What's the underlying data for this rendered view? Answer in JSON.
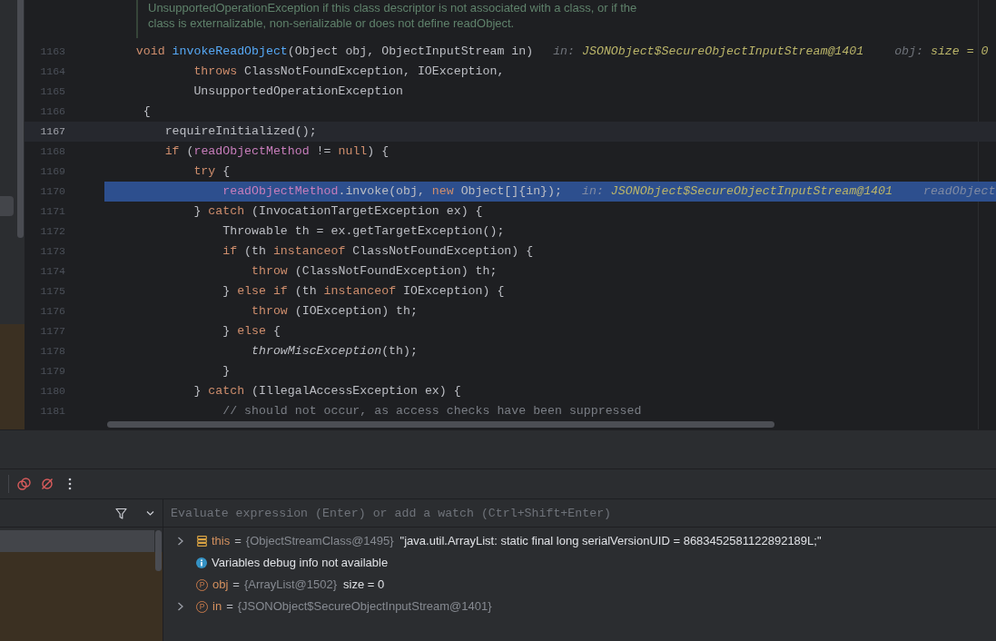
{
  "editor": {
    "doc_comment": {
      "lines": [
        "UnsupportedOperationException if this class descriptor is not associated with a class, or if the",
        "class is externalizable, non-serializable or does not define readObject."
      ]
    },
    "lines": [
      {
        "number": "1163",
        "caret": false,
        "execution_point": false,
        "tokens": [
          {
            "text": "    void",
            "kind": "keyword"
          },
          {
            "text": " invokeReadObject",
            "kind": "method_declaration"
          },
          {
            "text": "(Object obj, ObjectInputStream in)",
            "kind": "plain"
          }
        ],
        "hints": [
          {
            "label": "in:",
            "value": "JSONObject$SecureObjectInputStream@1401"
          },
          {
            "label": "obj:",
            "value": "size = 0"
          }
        ]
      },
      {
        "number": "1164",
        "caret": false,
        "execution_point": false,
        "tokens": [
          {
            "text": "            throws",
            "kind": "keyword"
          },
          {
            "text": " ClassNotFoundException, IOException,",
            "kind": "plain"
          }
        ]
      },
      {
        "number": "1165",
        "caret": false,
        "execution_point": false,
        "tokens": [
          {
            "text": "            UnsupportedOperationException",
            "kind": "plain"
          }
        ]
      },
      {
        "number": "1166",
        "caret": false,
        "execution_point": false,
        "tokens": [
          {
            "text": "     {",
            "kind": "plain"
          }
        ]
      },
      {
        "number": "1167",
        "caret": true,
        "execution_point": false,
        "tokens": [
          {
            "text": "        requireInitialized();",
            "kind": "plain"
          }
        ]
      },
      {
        "number": "1168",
        "caret": false,
        "execution_point": false,
        "tokens": [
          {
            "text": "        if",
            "kind": "keyword"
          },
          {
            "text": " (",
            "kind": "plain"
          },
          {
            "text": "readObjectMethod",
            "kind": "field"
          },
          {
            "text": " != ",
            "kind": "plain"
          },
          {
            "text": "null",
            "kind": "keyword"
          },
          {
            "text": ") {",
            "kind": "plain"
          }
        ]
      },
      {
        "number": "1169",
        "caret": false,
        "execution_point": false,
        "tokens": [
          {
            "text": "            try",
            "kind": "keyword"
          },
          {
            "text": " {",
            "kind": "plain"
          }
        ]
      },
      {
        "number": "1170",
        "caret": false,
        "execution_point": true,
        "tokens": [
          {
            "text": "                readObjectMethod",
            "kind": "field"
          },
          {
            "text": ".invoke(obj, ",
            "kind": "plain"
          },
          {
            "text": "new",
            "kind": "keyword"
          },
          {
            "text": " Object[]{in});",
            "kind": "plain"
          }
        ],
        "hints": [
          {
            "label": "in:",
            "value": "JSONObject$SecureObjectInputStream@1401"
          },
          {
            "label": "readObject"
          }
        ]
      },
      {
        "number": "1171",
        "caret": false,
        "execution_point": false,
        "tokens": [
          {
            "text": "            } ",
            "kind": "plain"
          },
          {
            "text": "catch",
            "kind": "keyword"
          },
          {
            "text": " (InvocationTargetException ex) {",
            "kind": "plain"
          }
        ]
      },
      {
        "number": "1172",
        "caret": false,
        "execution_point": false,
        "tokens": [
          {
            "text": "                Throwable th = ex.getTargetException();",
            "kind": "plain"
          }
        ]
      },
      {
        "number": "1173",
        "caret": false,
        "execution_point": false,
        "tokens": [
          {
            "text": "                if",
            "kind": "keyword"
          },
          {
            "text": " (th ",
            "kind": "plain"
          },
          {
            "text": "instanceof",
            "kind": "keyword"
          },
          {
            "text": " ClassNotFoundException) {",
            "kind": "plain"
          }
        ]
      },
      {
        "number": "1174",
        "caret": false,
        "execution_point": false,
        "tokens": [
          {
            "text": "                    throw",
            "kind": "keyword"
          },
          {
            "text": " (ClassNotFoundException) th;",
            "kind": "plain"
          }
        ]
      },
      {
        "number": "1175",
        "caret": false,
        "execution_point": false,
        "tokens": [
          {
            "text": "                } ",
            "kind": "plain"
          },
          {
            "text": "else if",
            "kind": "keyword"
          },
          {
            "text": " (th ",
            "kind": "plain"
          },
          {
            "text": "instanceof",
            "kind": "keyword"
          },
          {
            "text": " IOException) {",
            "kind": "plain"
          }
        ]
      },
      {
        "number": "1176",
        "caret": false,
        "execution_point": false,
        "tokens": [
          {
            "text": "                    throw",
            "kind": "keyword"
          },
          {
            "text": " (IOException) th;",
            "kind": "plain"
          }
        ]
      },
      {
        "number": "1177",
        "caret": false,
        "execution_point": false,
        "tokens": [
          {
            "text": "                } ",
            "kind": "plain"
          },
          {
            "text": "else",
            "kind": "keyword"
          },
          {
            "text": " {",
            "kind": "plain"
          }
        ]
      },
      {
        "number": "1178",
        "caret": false,
        "execution_point": false,
        "tokens": [
          {
            "text": "                    throwMiscException",
            "kind": "static_call"
          },
          {
            "text": "(th);",
            "kind": "plain"
          }
        ]
      },
      {
        "number": "1179",
        "caret": false,
        "execution_point": false,
        "tokens": [
          {
            "text": "                }",
            "kind": "plain"
          }
        ]
      },
      {
        "number": "1180",
        "caret": false,
        "execution_point": false,
        "tokens": [
          {
            "text": "            } ",
            "kind": "plain"
          },
          {
            "text": "catch",
            "kind": "keyword"
          },
          {
            "text": " (IllegalAccessException ex) {",
            "kind": "plain"
          }
        ]
      },
      {
        "number": "1181",
        "caret": false,
        "execution_point": false,
        "tokens": [
          {
            "text": "                // should not occur, as access checks have been suppressed",
            "kind": "comment"
          }
        ]
      }
    ]
  },
  "debugger": {
    "evaluate_field": {
      "placeholder": "Evaluate expression (Enter) or add a watch (Ctrl+Shift+Enter)"
    },
    "variables": [
      {
        "kind": "field",
        "expandable": true,
        "name": "this",
        "operator": "=",
        "reference": "{ObjectStreamClass@1495}",
        "value": "\"java.util.ArrayList: static final long serialVersionUID = 8683452581122892189L;\""
      },
      {
        "kind": "info",
        "expandable": false,
        "text": "Variables debug info not available"
      },
      {
        "kind": "parameter",
        "expandable": false,
        "badge": "P",
        "name": "obj",
        "operator": "=",
        "reference": "{ArrayList@1502}",
        "value": "size = 0"
      },
      {
        "kind": "parameter",
        "expandable": true,
        "badge": "P",
        "name": "in",
        "operator": "=",
        "reference": "{JSONObject$SecureObjectInputStream@1401}"
      }
    ]
  }
}
